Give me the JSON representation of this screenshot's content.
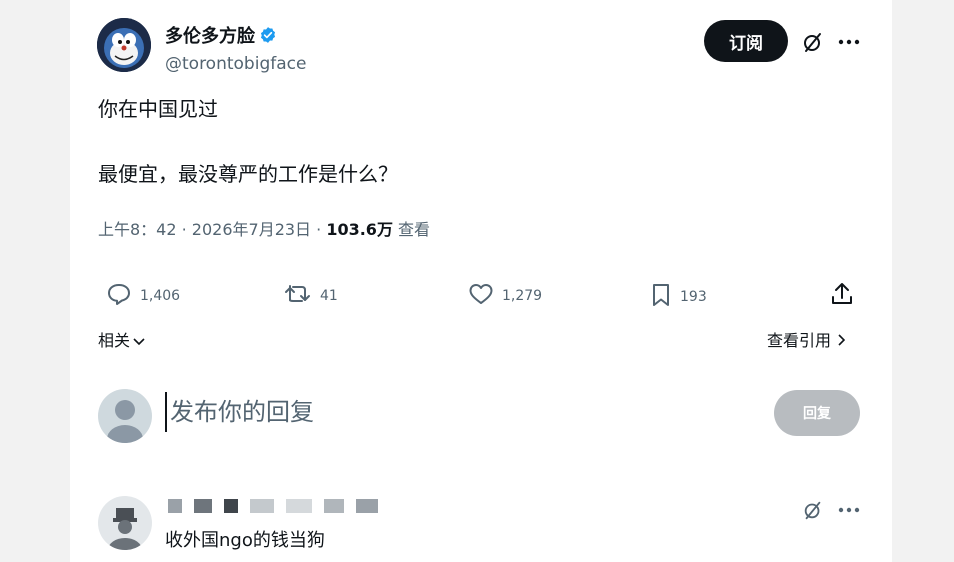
{
  "author": {
    "name": "多伦多方脸",
    "handle": "@torontobigface"
  },
  "header": {
    "subscribe_label": "订阅"
  },
  "post": {
    "line1": "你在中国见过",
    "line2": "最便宜，最没尊严的工作是什么？"
  },
  "meta": {
    "time": "上午8：42 · 2026年7月23日 · ",
    "views_count": "103.6万",
    "views_label": " 查看"
  },
  "actions": {
    "replies": "1,406",
    "reposts": "41",
    "likes": "1,279",
    "bookmarks": "193"
  },
  "related": {
    "label": "相关",
    "quotes_label": "查看引用"
  },
  "reply_box": {
    "placeholder": "发布你的回复",
    "button_label": "回复"
  },
  "comment": {
    "text": "收外国ngo的钱当狗"
  },
  "colors": {
    "verified": "#1d9bf0",
    "text_primary": "#0f1419",
    "text_secondary": "#536471"
  }
}
